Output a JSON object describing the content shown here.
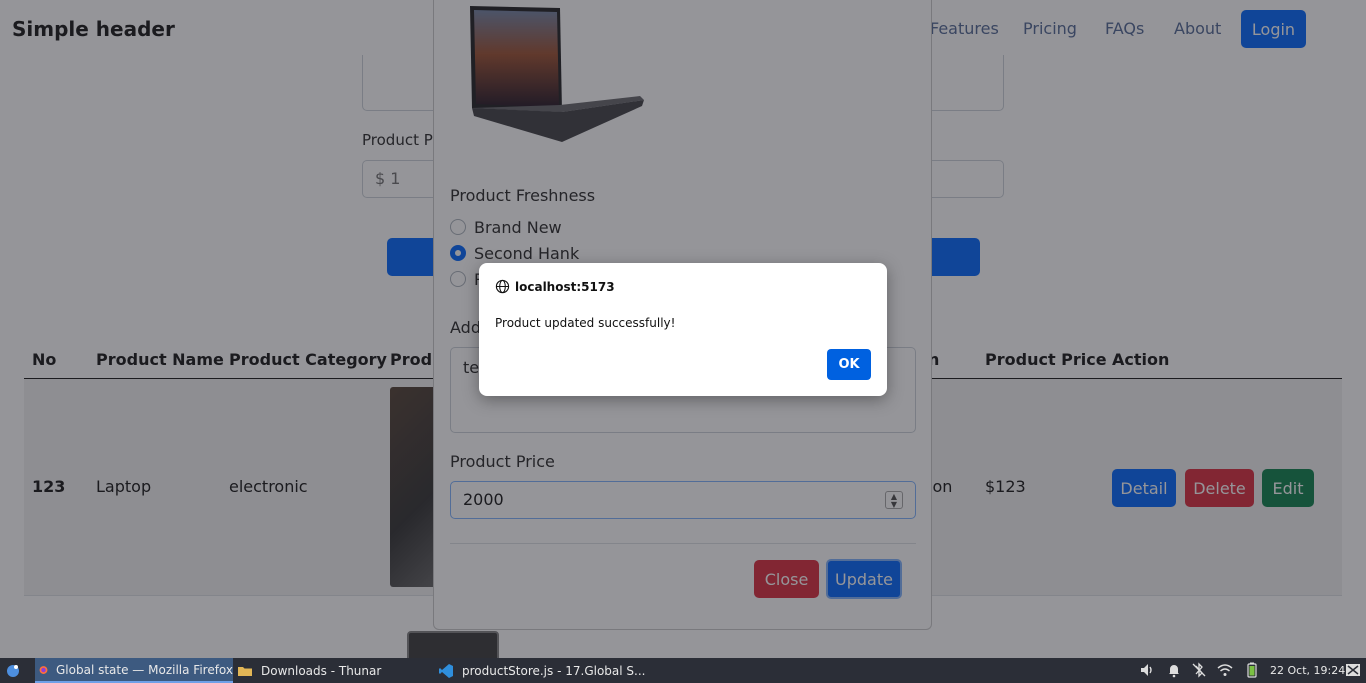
{
  "header": {
    "brand": "Simple header",
    "nav": [
      "Features",
      "Pricing",
      "FAQs",
      "About"
    ],
    "login": "Login"
  },
  "form_bg": {
    "price_label": "Product Pr",
    "price_value": "$ 1"
  },
  "table": {
    "headers": [
      "No",
      "Product Name",
      "Product Category",
      "Produ",
      "n",
      "Product Price",
      "Action"
    ],
    "row": {
      "no": "123",
      "name": "Laptop",
      "category": "electronic",
      "freshness": "ion",
      "price": "$123",
      "actions": [
        "Detail",
        "Delete",
        "Edit"
      ]
    }
  },
  "modal": {
    "freshness_label": "Product Freshness",
    "options": [
      "Brand New",
      "Second Hank",
      "R"
    ],
    "selected_option": "Second Hank",
    "desc_label": "Add",
    "desc_value": "tes",
    "price_label": "Product Price",
    "price_value": "2000",
    "close": "Close",
    "update": "Update"
  },
  "alert": {
    "origin": "localhost:5173",
    "message": "Product updated successfully!",
    "ok": "OK"
  },
  "taskbar": {
    "items": [
      "Global state — Mozilla Firefox",
      "Downloads - Thunar",
      "productStore.js - 17.Global S..."
    ],
    "active_item": "Global state — Mozilla Firefox",
    "clock": "22 Oct, 19:24"
  },
  "colors": {
    "primary": "#0d6efd",
    "danger": "#dc3545",
    "success": "#198754",
    "dialog_ok": "#0061e0",
    "taskbar": "#2b2e37"
  }
}
